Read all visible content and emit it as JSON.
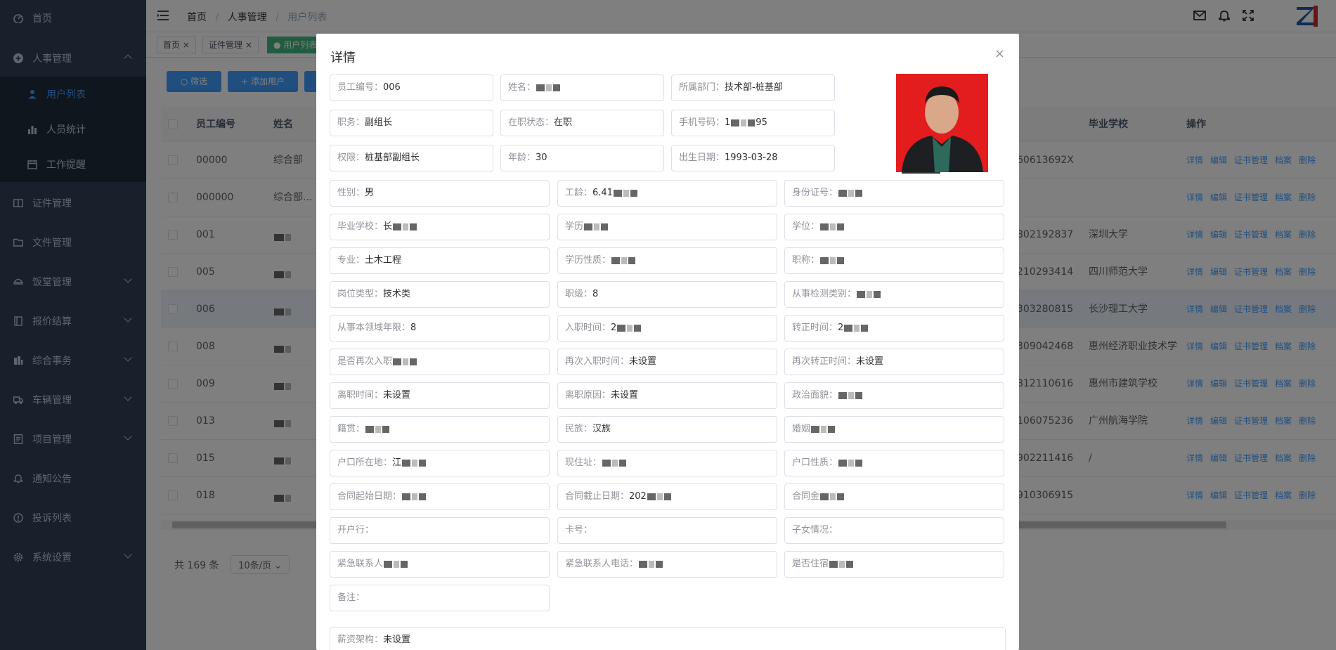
{
  "sidebar": {
    "items": [
      {
        "label": "首页",
        "icon": "dashboard-icon"
      },
      {
        "label": "人事管理",
        "icon": "plus-circle-icon"
      },
      {
        "label": "证件管理",
        "icon": "card-icon"
      },
      {
        "label": "文件管理",
        "icon": "folder-icon"
      },
      {
        "label": "饭堂管理",
        "icon": "bowl-icon"
      },
      {
        "label": "报价结算",
        "icon": "book-icon"
      },
      {
        "label": "综合事务",
        "icon": "building-icon"
      },
      {
        "label": "车辆管理",
        "icon": "truck-icon"
      },
      {
        "label": "项目管理",
        "icon": "document-icon"
      },
      {
        "label": "通知公告",
        "icon": "bell-icon"
      },
      {
        "label": "投诉列表",
        "icon": "alert-circle-icon"
      },
      {
        "label": "系统设置",
        "icon": "gear-icon"
      }
    ],
    "subitems": [
      {
        "label": "用户列表",
        "icon": "user-icon"
      },
      {
        "label": "人员统计",
        "icon": "bar-chart-icon"
      },
      {
        "label": "工作提醒",
        "icon": "calendar-icon"
      }
    ],
    "active_color": "#409eff",
    "bg_color": "#304156"
  },
  "breadcrumb": [
    "首页",
    "人事管理",
    "用户列表"
  ],
  "tags": [
    "首页",
    "证件管理",
    "用户列表"
  ],
  "toolbar": {
    "filter_label": "筛选",
    "add_label": "添加用户"
  },
  "table": {
    "headers": {
      "id": "员工编号",
      "name": "姓名",
      "school": "毕业学校",
      "ops": "操作"
    },
    "rows": [
      {
        "id": "00000",
        "name": "综合部",
        "idno": "60613692X",
        "school": ""
      },
      {
        "id": "000000",
        "name": "综合部...",
        "idno": "",
        "school": ""
      },
      {
        "id": "001",
        "name": "",
        "idno": "802192837",
        "school": "深圳大学"
      },
      {
        "id": "005",
        "name": "",
        "idno": "210293414",
        "school": "四川师范大学"
      },
      {
        "id": "006",
        "name": "",
        "idno": "303280815",
        "school": "长沙理工大学"
      },
      {
        "id": "008",
        "name": "",
        "idno": "309042468",
        "school": "惠州经济职业技术学"
      },
      {
        "id": "009",
        "name": "",
        "idno": "812110616",
        "school": "惠州市建筑学校"
      },
      {
        "id": "013",
        "name": "",
        "idno": "106075236",
        "school": "广州航海学院"
      },
      {
        "id": "015",
        "name": "",
        "idno": "902211416",
        "school": "/"
      },
      {
        "id": "018",
        "name": "",
        "idno": "910306915",
        "school": ""
      }
    ],
    "ops": [
      "详情",
      "编辑",
      "证书管理",
      "档案",
      "删除"
    ]
  },
  "pager": {
    "total": "共 169 条",
    "page_size": "10条/页"
  },
  "dialog": {
    "title": "详情",
    "close": "×",
    "top_fields": [
      {
        "label": "员工编号：",
        "value": "006"
      },
      {
        "label": "姓名：",
        "value": ""
      },
      {
        "label": "所属部门：",
        "value": "技术部-桩基部"
      },
      {
        "label": "职务：",
        "value": "副组长"
      },
      {
        "label": "在职状态：",
        "value": "在职"
      },
      {
        "label": "手机号码：",
        "value": "1"
      },
      {
        "label": "权限：",
        "value": "桩基部副组长"
      },
      {
        "label": "年龄：",
        "value": "30"
      },
      {
        "label": "出生日期：",
        "value": "1993-03-28"
      }
    ],
    "phone_tail": "95",
    "grid_fields": [
      {
        "label": "性别：",
        "value": "男"
      },
      {
        "label": "工龄：",
        "value": "6.41"
      },
      {
        "label": "身份证号：",
        "value": ""
      },
      {
        "label": "毕业学校：",
        "value": "长"
      },
      {
        "label": "学历",
        "value": ""
      },
      {
        "label": "学位：",
        "value": ""
      },
      {
        "label": "专业：",
        "value": "土木工程"
      },
      {
        "label": "学历性质：",
        "value": ""
      },
      {
        "label": "职称：",
        "value": ""
      },
      {
        "label": "岗位类型：",
        "value": "技术类"
      },
      {
        "label": "职级：",
        "value": "8"
      },
      {
        "label": "从事检测类别：",
        "value": ""
      },
      {
        "label": "从事本领域年限：",
        "value": "8"
      },
      {
        "label": "入职时间：",
        "value": "2"
      },
      {
        "label": "转正时间：",
        "value": "2"
      },
      {
        "label": "是否再次入职",
        "value": ""
      },
      {
        "label": "再次入职时间：",
        "value": "未设置"
      },
      {
        "label": "再次转正时间：",
        "value": "未设置"
      },
      {
        "label": "离职时间：",
        "value": "未设置"
      },
      {
        "label": "离职原因：",
        "value": "未设置"
      },
      {
        "label": "政治面貌：",
        "value": ""
      },
      {
        "label": "籍贯：",
        "value": ""
      },
      {
        "label": "民族：",
        "value": "汉族"
      },
      {
        "label": "婚姻",
        "value": ""
      },
      {
        "label": "户口所在地：",
        "value": "江"
      },
      {
        "label": "现住址：",
        "value": ""
      },
      {
        "label": "户口性质：",
        "value": ""
      },
      {
        "label": "合同起始日期：",
        "value": ""
      },
      {
        "label": "合同截止日期：",
        "value": "202"
      },
      {
        "label": "合同金",
        "value": ""
      },
      {
        "label": "开户行：",
        "value": ""
      },
      {
        "label": "卡号：",
        "value": ""
      },
      {
        "label": "子女情况：",
        "value": ""
      },
      {
        "label": "紧急联系人",
        "value": ""
      },
      {
        "label": "紧急联系人电话：",
        "value": ""
      },
      {
        "label": "是否住宿",
        "value": ""
      },
      {
        "label": "备注：",
        "value": ""
      }
    ],
    "salary": {
      "label": "薪资架构：",
      "value": "未设置"
    }
  }
}
